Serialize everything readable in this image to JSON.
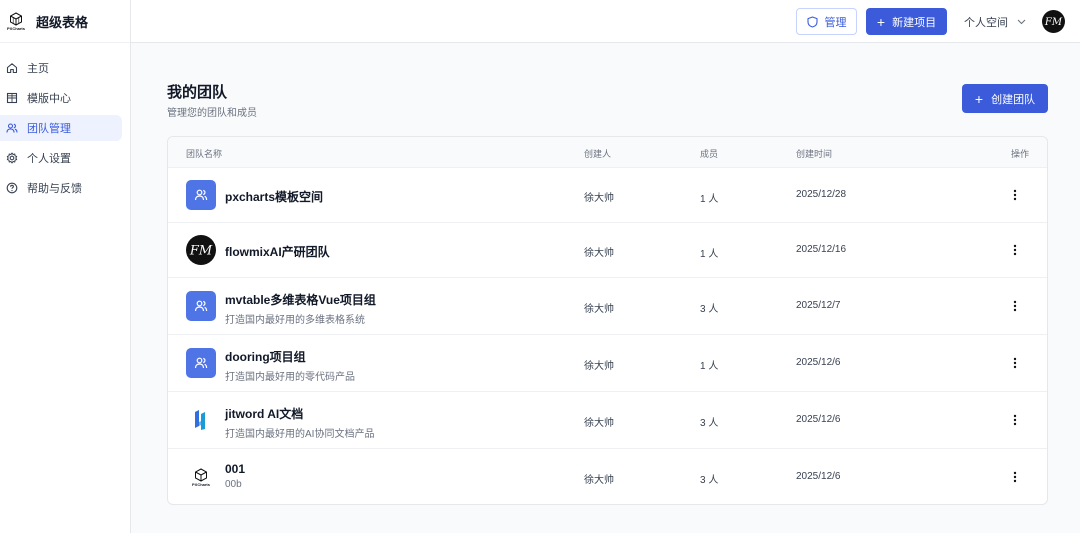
{
  "brand": {
    "name": "超级表格",
    "logo_text": "PXCharts"
  },
  "sidebar": {
    "items": [
      {
        "label": "主页",
        "icon": "home-icon",
        "active": false
      },
      {
        "label": "模版中心",
        "icon": "grid-icon",
        "active": false
      },
      {
        "label": "团队管理",
        "icon": "users-icon",
        "active": true
      },
      {
        "label": "个人设置",
        "icon": "gear-icon",
        "active": false
      },
      {
        "label": "帮助与反馈",
        "icon": "help-icon",
        "active": false
      }
    ]
  },
  "topbar": {
    "manage_label": "管理",
    "new_project_label": "新建项目",
    "space_label": "个人空间",
    "avatar_text": "FM"
  },
  "main": {
    "title": "我的团队",
    "subtitle": "管理您的团队和成员",
    "create_label": "创建团队"
  },
  "table": {
    "headers": {
      "name": "团队名称",
      "creator": "创建人",
      "members": "成员",
      "created": "创建时间",
      "actions": "操作"
    },
    "rows": [
      {
        "name": "pxcharts模板空间",
        "desc": "",
        "creator": "徐大帅",
        "members": "1 人",
        "created": "2025/12/28",
        "icon": "users-icon",
        "icon_style": "blue"
      },
      {
        "name": "flowmixAI产研团队",
        "desc": "",
        "creator": "徐大帅",
        "members": "1 人",
        "created": "2025/12/16",
        "icon": "fm-logo-icon",
        "icon_style": "black",
        "icon_text": "FM"
      },
      {
        "name": "mvtable多维表格Vue项目组",
        "desc": "打造国内最好用的多维表格系统",
        "creator": "徐大帅",
        "members": "3 人",
        "created": "2025/12/7",
        "icon": "users-icon",
        "icon_style": "blue"
      },
      {
        "name": "dooring项目组",
        "desc": "打造国内最好用的零代码产品",
        "creator": "徐大帅",
        "members": "1 人",
        "created": "2025/12/6",
        "icon": "users-icon",
        "icon_style": "blue"
      },
      {
        "name": "jitword AI文档",
        "desc": "打造国内最好用的AI协同文档产品",
        "creator": "徐大帅",
        "members": "3 人",
        "created": "2025/12/6",
        "icon": "jitword-logo-icon",
        "icon_style": "plain"
      },
      {
        "name": "001",
        "desc": "00b",
        "creator": "徐大帅",
        "members": "3 人",
        "created": "2025/12/6",
        "icon": "pxcharts-logo-icon",
        "icon_style": "plain",
        "icon_text": "PXCharts"
      }
    ]
  },
  "colors": {
    "accent": "#3b5bdb",
    "team_icon_blue": "#4f74e6"
  }
}
